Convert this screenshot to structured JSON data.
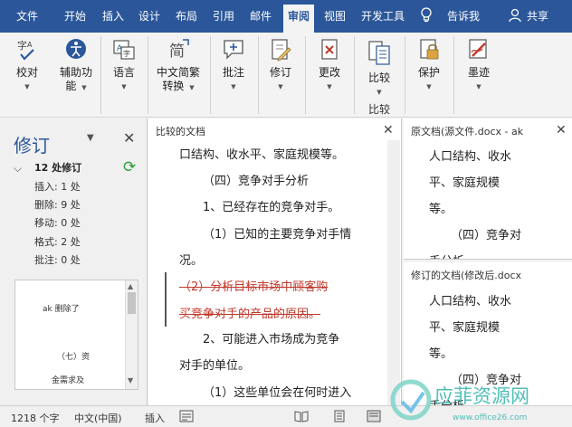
{
  "tabs": [
    "文件",
    "开始",
    "插入",
    "设计",
    "布局",
    "引用",
    "邮件",
    "审阅",
    "视图",
    "开发工具"
  ],
  "tell_me": "告诉我",
  "share": "共享",
  "ribbon": {
    "proofing": "校对",
    "accessibility": [
      "辅助功",
      "能"
    ],
    "language": "语言",
    "chinese_convert": [
      "中文简繁",
      "转换"
    ],
    "comments": "批注",
    "tracking": "修订",
    "changes": "更改",
    "compare": "比较",
    "compare_group": "比较",
    "protect": "保护",
    "ink": "墨迹"
  },
  "revision_pane": {
    "title": "修订",
    "summary": "12 处修订",
    "lines": [
      "插入: 1 处",
      "删除: 9 处",
      "移动: 0 处",
      "格式: 2 处",
      "批注: 0 处"
    ],
    "list_items": [
      "ak 删除了",
      "（七）资",
      "金需求及"
    ]
  },
  "compared_doc": {
    "title": "比较的文档",
    "lines": [
      "口结构、收水平、家庭规模等。",
      "（四）竞争对手分析",
      "1、已经存在的竞争对手。",
      "（1）已知的主要竞争对手情",
      "况。",
      "（2）分析目标市场中顾客购",
      "买竞争对手的产品的原因。",
      "2、可能进入市场成为竞争",
      "对手的单位。",
      "（1）这些单位会在何时进入"
    ]
  },
  "source_doc": {
    "title": "原文档(源文件.docx - ak",
    "lines": [
      "人口结构、收水",
      "平、家庭规模",
      "等。",
      "（四）竞争对",
      "手分析"
    ]
  },
  "modified_doc": {
    "title": "修订的文档(修改后.docx",
    "lines": [
      "人口结构、收水",
      "平、家庭规模",
      "等。",
      "（四）竞争对",
      "手分析"
    ]
  },
  "status": {
    "word_count": "1218 个字",
    "language": "中文(中国)",
    "insert_mode": "插入"
  },
  "watermark": {
    "text": "应菲资源网",
    "url": "www.office26.com"
  },
  "colors": {
    "accent": "#2b579a",
    "deleted_text": "#c0392b",
    "refresh": "#2e9e3e"
  }
}
